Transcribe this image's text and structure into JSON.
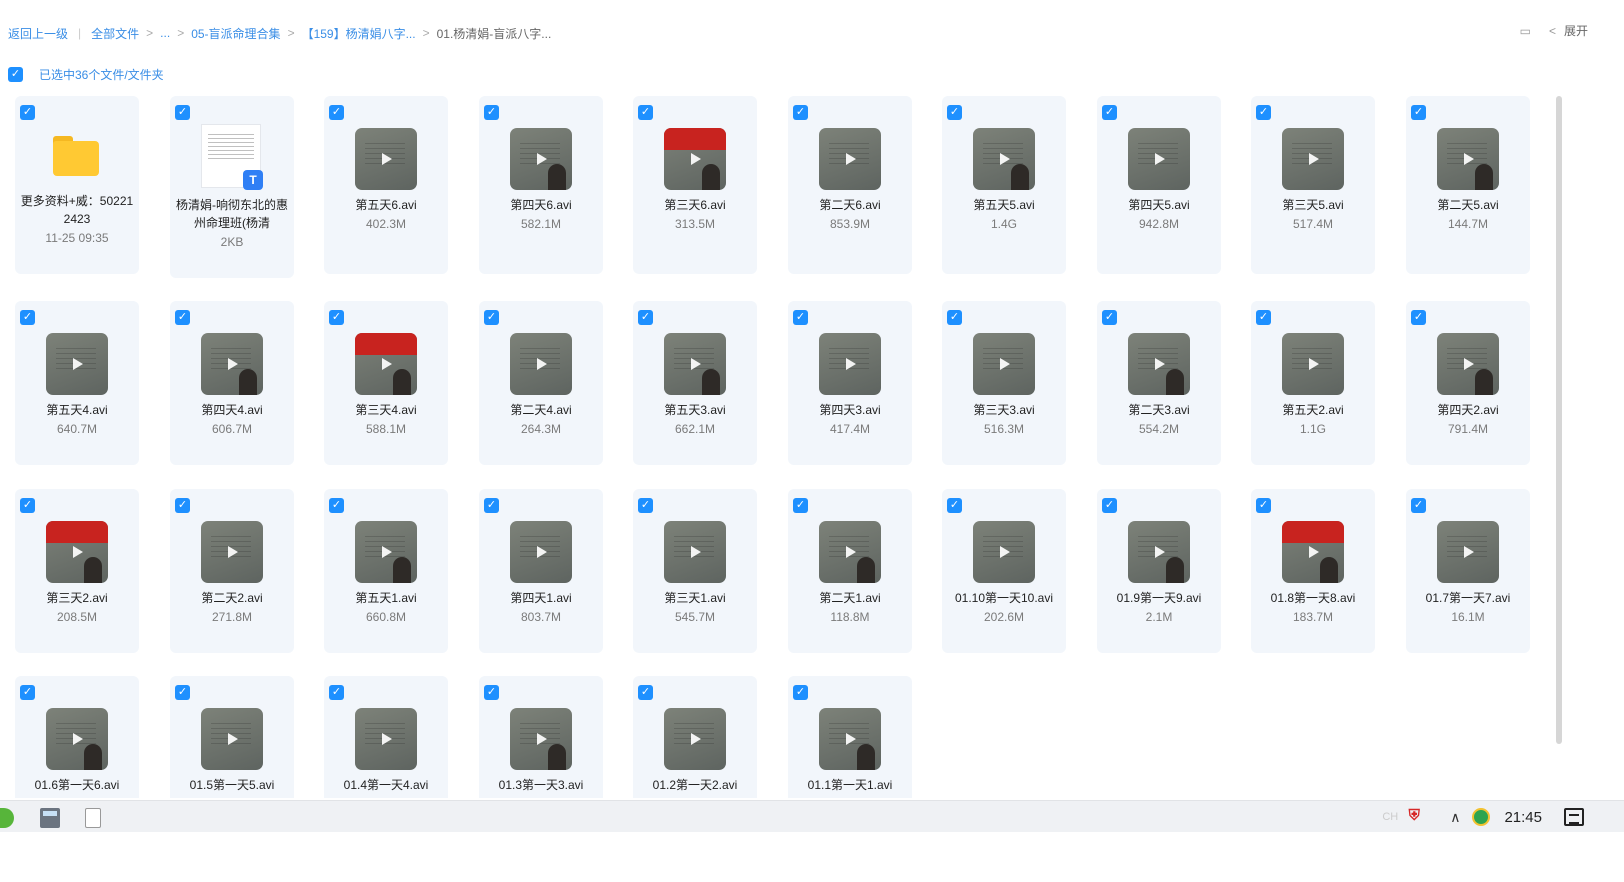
{
  "breadcrumb": {
    "back": "返回上一级",
    "all_files": "全部文件",
    "ellipsis": "...",
    "level1": "05-盲派命理合集",
    "level2": "【159】杨清娟八字...",
    "current": "01.杨清娟-盲派八字..."
  },
  "toolbar": {
    "expand_label": "展开"
  },
  "selection": {
    "label": "已选中36个文件/文件夹"
  },
  "files": [
    {
      "name": "更多资料+威：502212423",
      "meta": "11-25 09:35",
      "kind": "folder"
    },
    {
      "name": "杨清娟-响彻东北的惠州命理班(杨清",
      "meta": "2KB",
      "kind": "doc"
    },
    {
      "name": "第五天6.avi",
      "meta": "402.3M",
      "kind": "video"
    },
    {
      "name": "第四天6.avi",
      "meta": "582.1M",
      "kind": "video"
    },
    {
      "name": "第三天6.avi",
      "meta": "313.5M",
      "kind": "video"
    },
    {
      "name": "第二天6.avi",
      "meta": "853.9M",
      "kind": "video"
    },
    {
      "name": "第五天5.avi",
      "meta": "1.4G",
      "kind": "video"
    },
    {
      "name": "第四天5.avi",
      "meta": "942.8M",
      "kind": "video"
    },
    {
      "name": "第三天5.avi",
      "meta": "517.4M",
      "kind": "video"
    },
    {
      "name": "第二天5.avi",
      "meta": "144.7M",
      "kind": "video"
    },
    {
      "name": "第五天4.avi",
      "meta": "640.7M",
      "kind": "video"
    },
    {
      "name": "第四天4.avi",
      "meta": "606.7M",
      "kind": "video"
    },
    {
      "name": "第三天4.avi",
      "meta": "588.1M",
      "kind": "video"
    },
    {
      "name": "第二天4.avi",
      "meta": "264.3M",
      "kind": "video"
    },
    {
      "name": "第五天3.avi",
      "meta": "662.1M",
      "kind": "video"
    },
    {
      "name": "第四天3.avi",
      "meta": "417.4M",
      "kind": "video"
    },
    {
      "name": "第三天3.avi",
      "meta": "516.3M",
      "kind": "video"
    },
    {
      "name": "第二天3.avi",
      "meta": "554.2M",
      "kind": "video"
    },
    {
      "name": "第五天2.avi",
      "meta": "1.1G",
      "kind": "video"
    },
    {
      "name": "第四天2.avi",
      "meta": "791.4M",
      "kind": "video"
    },
    {
      "name": "第三天2.avi",
      "meta": "208.5M",
      "kind": "video"
    },
    {
      "name": "第二天2.avi",
      "meta": "271.8M",
      "kind": "video"
    },
    {
      "name": "第五天1.avi",
      "meta": "660.8M",
      "kind": "video"
    },
    {
      "name": "第四天1.avi",
      "meta": "803.7M",
      "kind": "video"
    },
    {
      "name": "第三天1.avi",
      "meta": "545.7M",
      "kind": "video"
    },
    {
      "name": "第二天1.avi",
      "meta": "118.8M",
      "kind": "video"
    },
    {
      "name": "01.10第一天10.avi",
      "meta": "202.6M",
      "kind": "video"
    },
    {
      "name": "01.9第一天9.avi",
      "meta": "2.1M",
      "kind": "video"
    },
    {
      "name": "01.8第一天8.avi",
      "meta": "183.7M",
      "kind": "video"
    },
    {
      "name": "01.7第一天7.avi",
      "meta": "16.1M",
      "kind": "video"
    },
    {
      "name": "01.6第一天6.avi",
      "meta": "",
      "kind": "video"
    },
    {
      "name": "01.5第一天5.avi",
      "meta": "",
      "kind": "video"
    },
    {
      "name": "01.4第一天4.avi",
      "meta": "",
      "kind": "video"
    },
    {
      "name": "01.3第一天3.avi",
      "meta": "",
      "kind": "video"
    },
    {
      "name": "01.2第一天2.avi",
      "meta": "",
      "kind": "video"
    },
    {
      "name": "01.1第一天1.avi",
      "meta": "",
      "kind": "video"
    }
  ],
  "taskbar": {
    "clock": "21:45",
    "input_method": "CH"
  },
  "colors": {
    "accent": "#1e90ff",
    "link": "#3a8ee6",
    "tile_bg": "#f2f6fb"
  }
}
